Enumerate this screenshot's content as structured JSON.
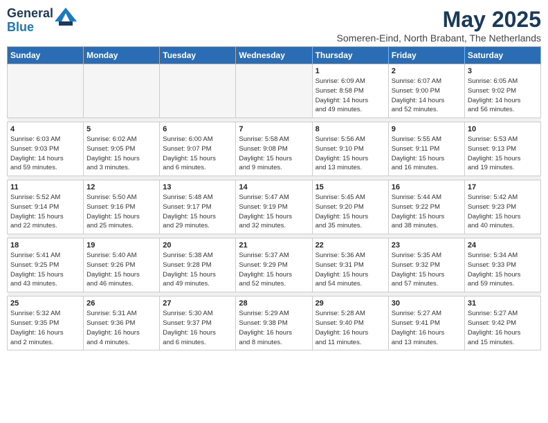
{
  "header": {
    "logo_line1": "General",
    "logo_line2": "Blue",
    "month_year": "May 2025",
    "subtitle": "Someren-Eind, North Brabant, The Netherlands"
  },
  "weekdays": [
    "Sunday",
    "Monday",
    "Tuesday",
    "Wednesday",
    "Thursday",
    "Friday",
    "Saturday"
  ],
  "weeks": [
    [
      {
        "day": "",
        "details": ""
      },
      {
        "day": "",
        "details": ""
      },
      {
        "day": "",
        "details": ""
      },
      {
        "day": "",
        "details": ""
      },
      {
        "day": "1",
        "details": "Sunrise: 6:09 AM\nSunset: 8:58 PM\nDaylight: 14 hours\nand 49 minutes."
      },
      {
        "day": "2",
        "details": "Sunrise: 6:07 AM\nSunset: 9:00 PM\nDaylight: 14 hours\nand 52 minutes."
      },
      {
        "day": "3",
        "details": "Sunrise: 6:05 AM\nSunset: 9:02 PM\nDaylight: 14 hours\nand 56 minutes."
      }
    ],
    [
      {
        "day": "4",
        "details": "Sunrise: 6:03 AM\nSunset: 9:03 PM\nDaylight: 14 hours\nand 59 minutes."
      },
      {
        "day": "5",
        "details": "Sunrise: 6:02 AM\nSunset: 9:05 PM\nDaylight: 15 hours\nand 3 minutes."
      },
      {
        "day": "6",
        "details": "Sunrise: 6:00 AM\nSunset: 9:07 PM\nDaylight: 15 hours\nand 6 minutes."
      },
      {
        "day": "7",
        "details": "Sunrise: 5:58 AM\nSunset: 9:08 PM\nDaylight: 15 hours\nand 9 minutes."
      },
      {
        "day": "8",
        "details": "Sunrise: 5:56 AM\nSunset: 9:10 PM\nDaylight: 15 hours\nand 13 minutes."
      },
      {
        "day": "9",
        "details": "Sunrise: 5:55 AM\nSunset: 9:11 PM\nDaylight: 15 hours\nand 16 minutes."
      },
      {
        "day": "10",
        "details": "Sunrise: 5:53 AM\nSunset: 9:13 PM\nDaylight: 15 hours\nand 19 minutes."
      }
    ],
    [
      {
        "day": "11",
        "details": "Sunrise: 5:52 AM\nSunset: 9:14 PM\nDaylight: 15 hours\nand 22 minutes."
      },
      {
        "day": "12",
        "details": "Sunrise: 5:50 AM\nSunset: 9:16 PM\nDaylight: 15 hours\nand 25 minutes."
      },
      {
        "day": "13",
        "details": "Sunrise: 5:48 AM\nSunset: 9:17 PM\nDaylight: 15 hours\nand 29 minutes."
      },
      {
        "day": "14",
        "details": "Sunrise: 5:47 AM\nSunset: 9:19 PM\nDaylight: 15 hours\nand 32 minutes."
      },
      {
        "day": "15",
        "details": "Sunrise: 5:45 AM\nSunset: 9:20 PM\nDaylight: 15 hours\nand 35 minutes."
      },
      {
        "day": "16",
        "details": "Sunrise: 5:44 AM\nSunset: 9:22 PM\nDaylight: 15 hours\nand 38 minutes."
      },
      {
        "day": "17",
        "details": "Sunrise: 5:42 AM\nSunset: 9:23 PM\nDaylight: 15 hours\nand 40 minutes."
      }
    ],
    [
      {
        "day": "18",
        "details": "Sunrise: 5:41 AM\nSunset: 9:25 PM\nDaylight: 15 hours\nand 43 minutes."
      },
      {
        "day": "19",
        "details": "Sunrise: 5:40 AM\nSunset: 9:26 PM\nDaylight: 15 hours\nand 46 minutes."
      },
      {
        "day": "20",
        "details": "Sunrise: 5:38 AM\nSunset: 9:28 PM\nDaylight: 15 hours\nand 49 minutes."
      },
      {
        "day": "21",
        "details": "Sunrise: 5:37 AM\nSunset: 9:29 PM\nDaylight: 15 hours\nand 52 minutes."
      },
      {
        "day": "22",
        "details": "Sunrise: 5:36 AM\nSunset: 9:31 PM\nDaylight: 15 hours\nand 54 minutes."
      },
      {
        "day": "23",
        "details": "Sunrise: 5:35 AM\nSunset: 9:32 PM\nDaylight: 15 hours\nand 57 minutes."
      },
      {
        "day": "24",
        "details": "Sunrise: 5:34 AM\nSunset: 9:33 PM\nDaylight: 15 hours\nand 59 minutes."
      }
    ],
    [
      {
        "day": "25",
        "details": "Sunrise: 5:32 AM\nSunset: 9:35 PM\nDaylight: 16 hours\nand 2 minutes."
      },
      {
        "day": "26",
        "details": "Sunrise: 5:31 AM\nSunset: 9:36 PM\nDaylight: 16 hours\nand 4 minutes."
      },
      {
        "day": "27",
        "details": "Sunrise: 5:30 AM\nSunset: 9:37 PM\nDaylight: 16 hours\nand 6 minutes."
      },
      {
        "day": "28",
        "details": "Sunrise: 5:29 AM\nSunset: 9:38 PM\nDaylight: 16 hours\nand 8 minutes."
      },
      {
        "day": "29",
        "details": "Sunrise: 5:28 AM\nSunset: 9:40 PM\nDaylight: 16 hours\nand 11 minutes."
      },
      {
        "day": "30",
        "details": "Sunrise: 5:27 AM\nSunset: 9:41 PM\nDaylight: 16 hours\nand 13 minutes."
      },
      {
        "day": "31",
        "details": "Sunrise: 5:27 AM\nSunset: 9:42 PM\nDaylight: 16 hours\nand 15 minutes."
      }
    ]
  ]
}
